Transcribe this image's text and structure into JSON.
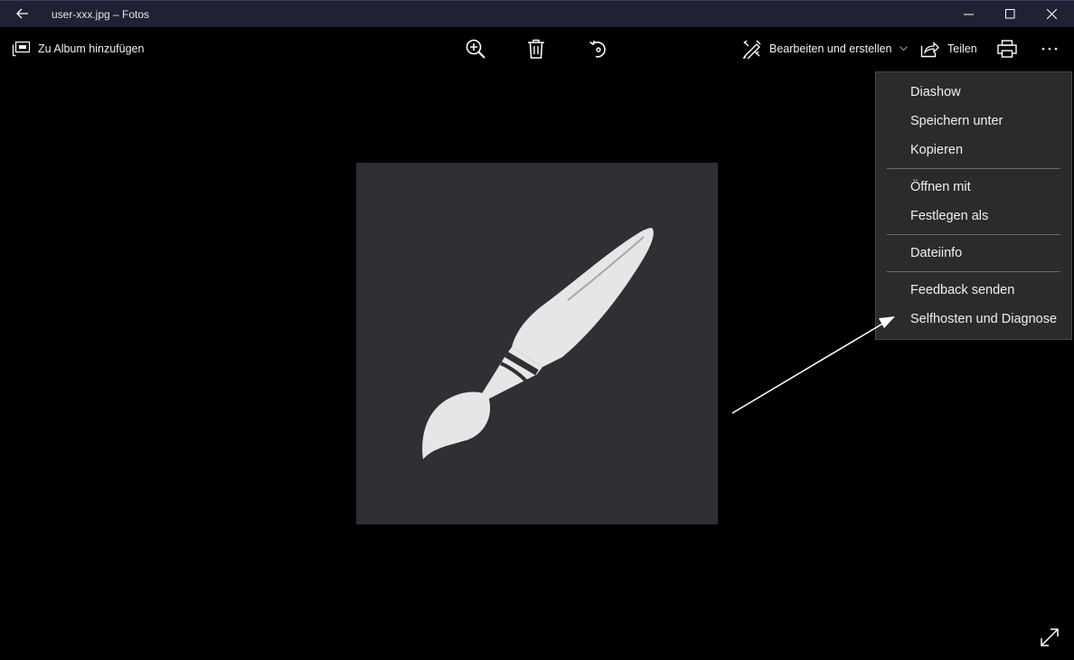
{
  "window": {
    "title": "user-xxx.jpg – Fotos",
    "back_icon": "arrow-left-icon",
    "controls": [
      "minimize-icon",
      "maximize-icon",
      "close-icon"
    ],
    "titlebar_color": "#1f2232"
  },
  "toolbar": {
    "add_to_album": "Zu Album hinzufügen",
    "zoom_icon": "zoom-in-icon",
    "delete_icon": "trash-icon",
    "rotate_icon": "rotate-icon",
    "edit_create": "Bearbeiten und erstellen",
    "share": "Teilen",
    "print_icon": "printer-icon",
    "more_icon": "ellipsis-icon"
  },
  "image": {
    "subject": "paintbrush-icon",
    "background_color": "#2e3036"
  },
  "menu": {
    "items": [
      {
        "label": "Diashow"
      },
      {
        "label": "Speichern unter"
      },
      {
        "label": "Kopieren"
      },
      {
        "label": "Öffnen mit"
      },
      {
        "label": "Festlegen als"
      },
      {
        "label": "Dateiinfo"
      },
      {
        "label": "Feedback senden"
      },
      {
        "label": "Selfhosten und Diagnose"
      }
    ]
  },
  "footer": {
    "fullscreen_icon": "expand-icon"
  }
}
